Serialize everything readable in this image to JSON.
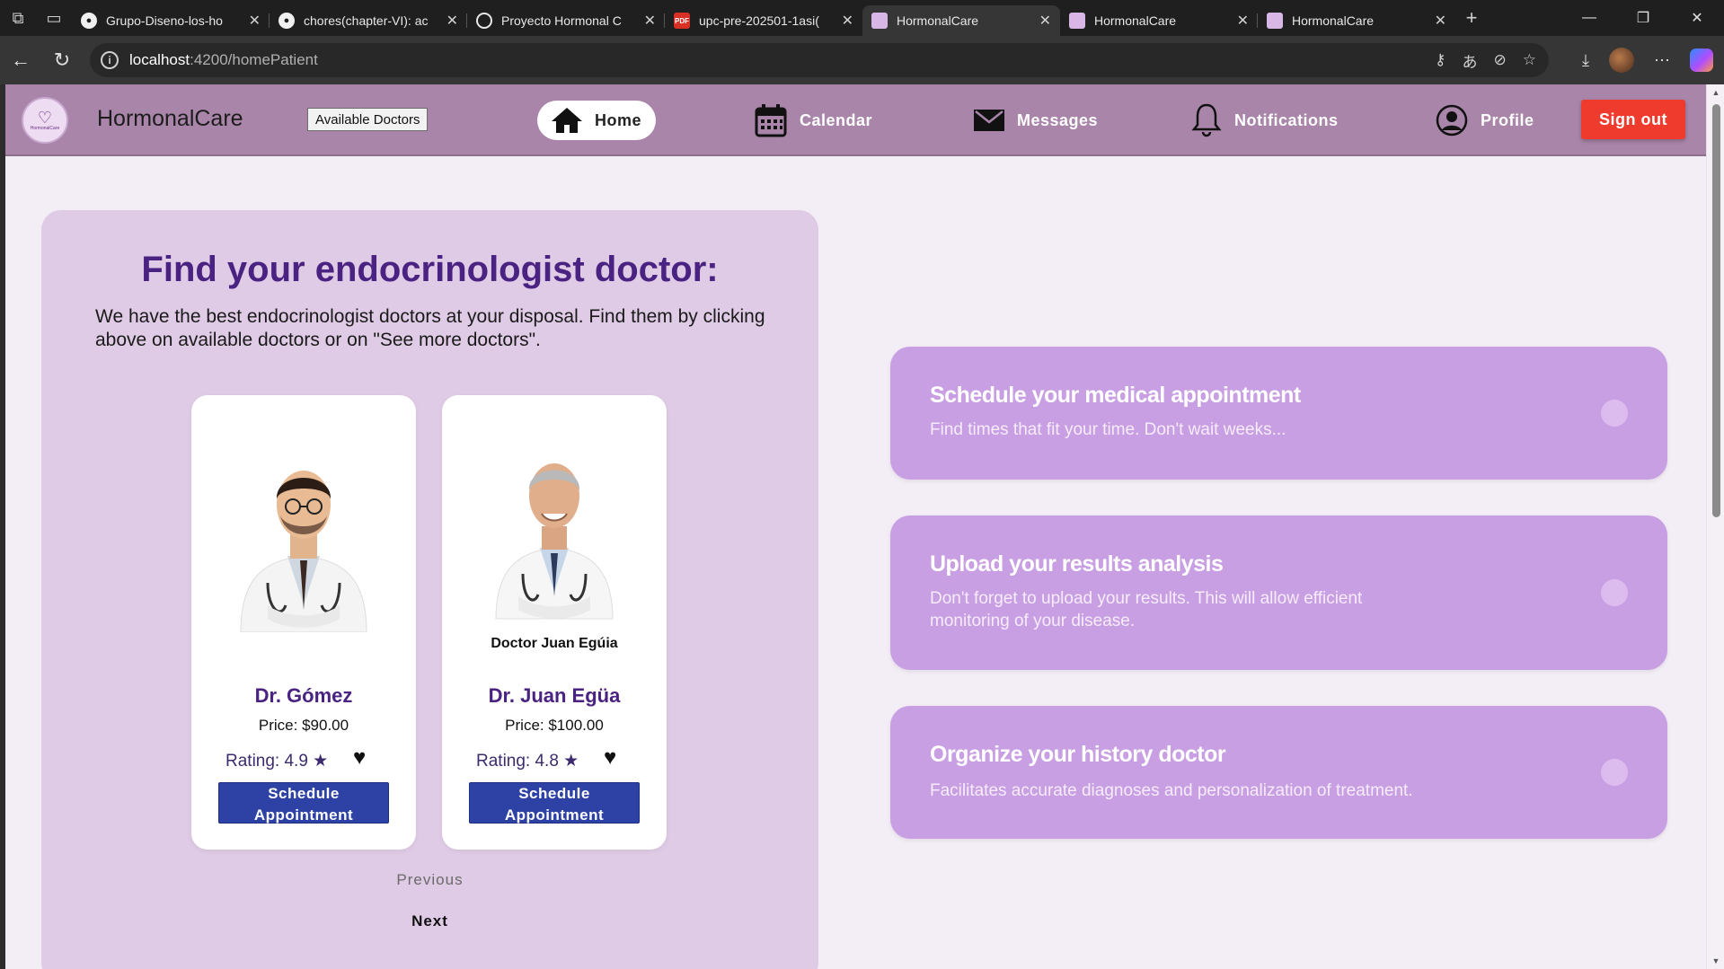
{
  "browser": {
    "tabs": [
      {
        "title": "Grupo-Diseno-los-ho",
        "favicon": "github-icon",
        "active": false
      },
      {
        "title": "chores(chapter-VI): ac",
        "favicon": "github-icon",
        "active": false
      },
      {
        "title": "Proyecto Hormonal C",
        "favicon": "openai-icon",
        "active": false
      },
      {
        "title": "upc-pre-202501-1asi(",
        "favicon": "pdf-icon",
        "active": false
      },
      {
        "title": "HormonalCare",
        "favicon": "hormonalcare-icon",
        "active": true
      },
      {
        "title": "HormonalCare",
        "favicon": "hormonalcare-icon",
        "active": false
      },
      {
        "title": "HormonalCare",
        "favicon": "hormonalcare-icon",
        "active": false
      }
    ],
    "address": {
      "host": "localhost",
      "path": ":4200/homePatient"
    }
  },
  "header": {
    "brand": "HormonalCare",
    "available_doctors": "Available Doctors",
    "nav": {
      "home": "Home",
      "calendar": "Calendar",
      "messages": "Messages",
      "notifications": "Notifications",
      "profile": "Profile"
    },
    "sign_out": "Sign out"
  },
  "finder": {
    "title": "Find your endocrinologist doctor:",
    "description": "We have the best endocrinologist doctors at your disposal. Find them by clicking above on available doctors or on \"See more doctors\".",
    "doctors": [
      {
        "caption": "",
        "name": "Dr. Gómez",
        "price": "Price: $90.00",
        "rating": "Rating: 4.9 ★",
        "button": "Schedule Appointment"
      },
      {
        "caption": "Doctor Juan Egúia",
        "name": "Dr. Juan Egüa",
        "price": "Price: $100.00",
        "rating": "Rating: 4.8 ★",
        "button": "Schedule Appointment"
      }
    ],
    "previous": "Previous",
    "next": "Next"
  },
  "features": [
    {
      "title": "Schedule your medical appointment",
      "description": "Find times that fit your time. Don't wait weeks..."
    },
    {
      "title": "Upload your results analysis",
      "description": "Don't forget to upload your results. This will allow efficient monitoring of your disease."
    },
    {
      "title": "Organize your history doctor",
      "description": "Facilitates accurate diagnoses and personalization of treatment."
    }
  ],
  "colors": {
    "header_bg": "#a985a9",
    "panel_bg": "#dfcbe5",
    "feature_bg": "#c99fe3",
    "title_purple": "#4a2282",
    "button_blue": "#2e42a6",
    "signout_red": "#ef3b2d"
  }
}
